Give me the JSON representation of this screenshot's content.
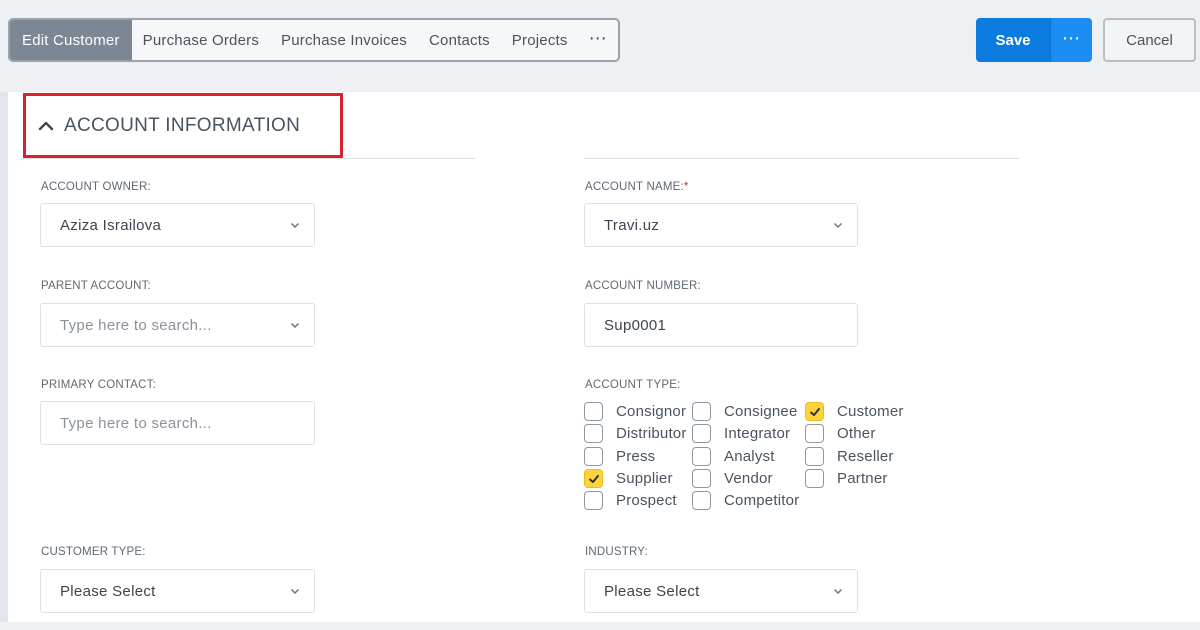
{
  "tabs": [
    {
      "label": "Edit Customer",
      "active": true
    },
    {
      "label": "Purchase Orders",
      "active": false
    },
    {
      "label": "Purchase Invoices",
      "active": false
    },
    {
      "label": "Contacts",
      "active": false
    },
    {
      "label": "Projects",
      "active": false
    }
  ],
  "tabs_more_label": "⋯",
  "actions": {
    "save_label": "Save",
    "save_more_label": "⋯",
    "cancel_label": "Cancel"
  },
  "section": {
    "title": "ACCOUNT INFORMATION",
    "collapse_icon": "chevron-up-icon"
  },
  "fields": {
    "account_owner": {
      "label": "ACCOUNT OWNER:",
      "value": "Aziza Israilova"
    },
    "account_name": {
      "label": "ACCOUNT NAME:",
      "required_mark": "*",
      "value": "Travi.uz"
    },
    "parent_account": {
      "label": "PARENT ACCOUNT:",
      "placeholder": "Type here to search..."
    },
    "account_number": {
      "label": "ACCOUNT NUMBER:",
      "value": "Sup0001"
    },
    "primary_contact": {
      "label": "PRIMARY CONTACT:",
      "placeholder": "Type here to search..."
    },
    "account_type": {
      "label": "ACCOUNT TYPE:"
    },
    "customer_type": {
      "label": "CUSTOMER TYPE:",
      "value": "Please Select"
    },
    "industry": {
      "label": "INDUSTRY:",
      "value": "Please Select"
    }
  },
  "account_types": [
    {
      "label": "Consignor",
      "checked": false
    },
    {
      "label": "Consignee",
      "checked": false
    },
    {
      "label": "Customer",
      "checked": true
    },
    {
      "label": "Distributor",
      "checked": false
    },
    {
      "label": "Integrator",
      "checked": false
    },
    {
      "label": "Other",
      "checked": false
    },
    {
      "label": "Press",
      "checked": false
    },
    {
      "label": "Analyst",
      "checked": false
    },
    {
      "label": "Reseller",
      "checked": false
    },
    {
      "label": "Supplier",
      "checked": true
    },
    {
      "label": "Vendor",
      "checked": false
    },
    {
      "label": "Partner",
      "checked": false
    },
    {
      "label": "Prospect",
      "checked": false
    },
    {
      "label": "Competitor",
      "checked": false
    }
  ],
  "colors": {
    "primary": "#0b7be0",
    "highlight": "#d9232d",
    "checked": "#ffd43b",
    "active_tab": "#7d8793"
  }
}
